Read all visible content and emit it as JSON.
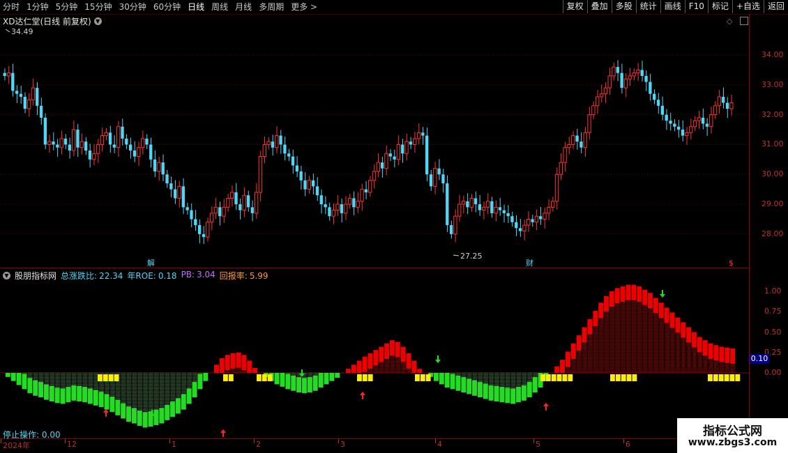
{
  "toolbar": {
    "timeframes": [
      "分时",
      "1分钟",
      "5分钟",
      "15分钟",
      "30分钟",
      "60分钟",
      "日线",
      "周线",
      "月线",
      "多周期",
      "更多 >"
    ],
    "active_timeframe": "日线",
    "tools": [
      "复权",
      "叠加",
      "多股",
      "统计",
      "画线",
      "F10",
      "标记",
      "+自选",
      "返回"
    ]
  },
  "main_chart": {
    "title": "XD达仁堂(日线 前复权)",
    "high_label": "34.49",
    "low_label": "27.25",
    "y_ticks": [
      "34.00",
      "33.00",
      "32.00",
      "31.00",
      "30.00",
      "29.00",
      "28.00"
    ],
    "markers": [
      "解",
      "财",
      "$"
    ]
  },
  "indicator": {
    "name": "股朋指标网",
    "stats": [
      {
        "label": "总涨跌比:",
        "value": "22.34",
        "color": "#4fd7f7"
      },
      {
        "label": "年ROE:",
        "value": "0.18",
        "color": "#4fd7f7"
      },
      {
        "label": "PB:",
        "value": "3.04",
        "color": "#c070ff"
      },
      {
        "label": "回报率:",
        "value": "5.99",
        "color": "#ff9933"
      }
    ],
    "y_ticks": [
      "1.00",
      "0.75",
      "0.50",
      "0.25",
      "0.00"
    ],
    "current_value": "0.10",
    "status_label": "停止操作:",
    "status_value": "0.00"
  },
  "x_axis": {
    "labels": [
      "2024年",
      "12",
      "1",
      "2",
      "3",
      "4",
      "5",
      "6"
    ]
  },
  "watermark": {
    "line1": "指标公式网",
    "line2": "www.zbgs3.com"
  },
  "colors": {
    "up": "#ff3333",
    "down": "#4fd7f7",
    "pos": "#ee0000",
    "neg": "#22dd22",
    "yellow": "#ffee00"
  },
  "chart_data": {
    "type": "candlestick",
    "ylim": [
      27.25,
      34.49
    ],
    "y_ticks": [
      28,
      29,
      30,
      31,
      32,
      33,
      34
    ],
    "closes": [
      33.3,
      33.4,
      32.8,
      32.7,
      32.6,
      32.2,
      32.5,
      32.9,
      32.3,
      31.9,
      31.0,
      31.1,
      31.0,
      30.9,
      31.2,
      31.0,
      30.8,
      31.5,
      30.9,
      31.1,
      30.8,
      30.5,
      30.7,
      31.0,
      31.3,
      31.4,
      31.0,
      30.9,
      31.6,
      31.2,
      31.0,
      30.8,
      30.6,
      30.9,
      31.2,
      31.0,
      30.5,
      30.1,
      30.4,
      30.0,
      29.7,
      29.5,
      29.2,
      29.6,
      28.9,
      28.8,
      28.5,
      28.3,
      28.0,
      27.9,
      28.4,
      28.7,
      28.9,
      28.6,
      28.9,
      29.2,
      29.4,
      29.0,
      28.8,
      29.3,
      28.9,
      28.7,
      29.4,
      30.6,
      31.0,
      31.1,
      30.9,
      31.3,
      31.0,
      30.7,
      30.6,
      30.3,
      30.1,
      29.8,
      29.5,
      29.8,
      29.6,
      29.3,
      29.0,
      28.9,
      28.6,
      28.8,
      29.0,
      28.7,
      29.0,
      29.2,
      28.9,
      29.1,
      29.5,
      29.4,
      29.8,
      30.1,
      30.4,
      30.2,
      30.7,
      30.6,
      30.5,
      31.0,
      30.7,
      31.1,
      31.0,
      31.2,
      31.4,
      31.3,
      30.0,
      29.6,
      30.2,
      30.0,
      29.7,
      28.3,
      28.0,
      28.6,
      29.0,
      29.1,
      28.9,
      29.2,
      29.0,
      28.8,
      28.9,
      29.1,
      28.7,
      28.9,
      28.8,
      28.7,
      28.6,
      28.4,
      28.2,
      28.1,
      28.3,
      28.5,
      28.4,
      28.6,
      28.5,
      28.7,
      28.9,
      29.1,
      30.0,
      30.4,
      30.9,
      31.0,
      31.3,
      31.1,
      30.9,
      31.4,
      32.0,
      32.3,
      32.6,
      32.7,
      32.9,
      33.3,
      33.6,
      33.4,
      32.9,
      33.2,
      33.3,
      33.4,
      33.5,
      33.3,
      33.1,
      32.7,
      32.5,
      32.3,
      32.0,
      31.8,
      31.7,
      31.6,
      31.5,
      31.3,
      31.4,
      31.6,
      31.8,
      31.9,
      31.7,
      31.6,
      32.0,
      32.3,
      32.6,
      32.4,
      32.2,
      32.4
    ]
  },
  "indicator_data": {
    "type": "bar",
    "ylim": [
      -0.75,
      1.0
    ],
    "values": [
      -0.0,
      -0.05,
      -0.1,
      -0.15,
      -0.2,
      -0.25,
      -0.28,
      -0.3,
      -0.33,
      -0.35,
      -0.37,
      -0.38,
      -0.36,
      -0.34,
      -0.35,
      -0.36,
      -0.38,
      -0.4,
      -0.42,
      -0.45,
      -0.48,
      -0.52,
      -0.56,
      -0.6,
      -0.62,
      -0.65,
      -0.67,
      -0.66,
      -0.64,
      -0.62,
      -0.58,
      -0.54,
      -0.5,
      -0.45,
      -0.38,
      -0.3,
      -0.2,
      -0.1,
      0.0,
      0.1,
      0.18,
      0.22,
      0.24,
      0.25,
      0.22,
      0.15,
      0.06,
      0.0,
      -0.05,
      -0.1,
      -0.14,
      -0.17,
      -0.2,
      -0.22,
      -0.24,
      -0.25,
      -0.24,
      -0.22,
      -0.18,
      -0.14,
      -0.1,
      -0.06,
      0.0,
      0.05,
      0.1,
      0.15,
      0.2,
      0.24,
      0.28,
      0.32,
      0.36,
      0.4,
      0.38,
      0.32,
      0.24,
      0.15,
      0.05,
      0.0,
      -0.05,
      -0.1,
      -0.14,
      -0.18,
      -0.2,
      -0.22,
      -0.24,
      -0.26,
      -0.28,
      -0.3,
      -0.32,
      -0.34,
      -0.35,
      -0.36,
      -0.37,
      -0.38,
      -0.36,
      -0.34,
      -0.3,
      -0.24,
      -0.18,
      -0.1,
      0.0,
      0.08,
      0.16,
      0.26,
      0.36,
      0.46,
      0.56,
      0.66,
      0.76,
      0.86,
      0.94,
      1.0,
      1.04,
      1.06,
      1.08,
      1.08,
      1.06,
      1.02,
      0.98,
      0.92,
      0.86,
      0.8,
      0.74,
      0.68,
      0.62,
      0.56,
      0.5,
      0.44,
      0.4,
      0.36,
      0.34,
      0.32,
      0.31,
      0.3
    ]
  }
}
